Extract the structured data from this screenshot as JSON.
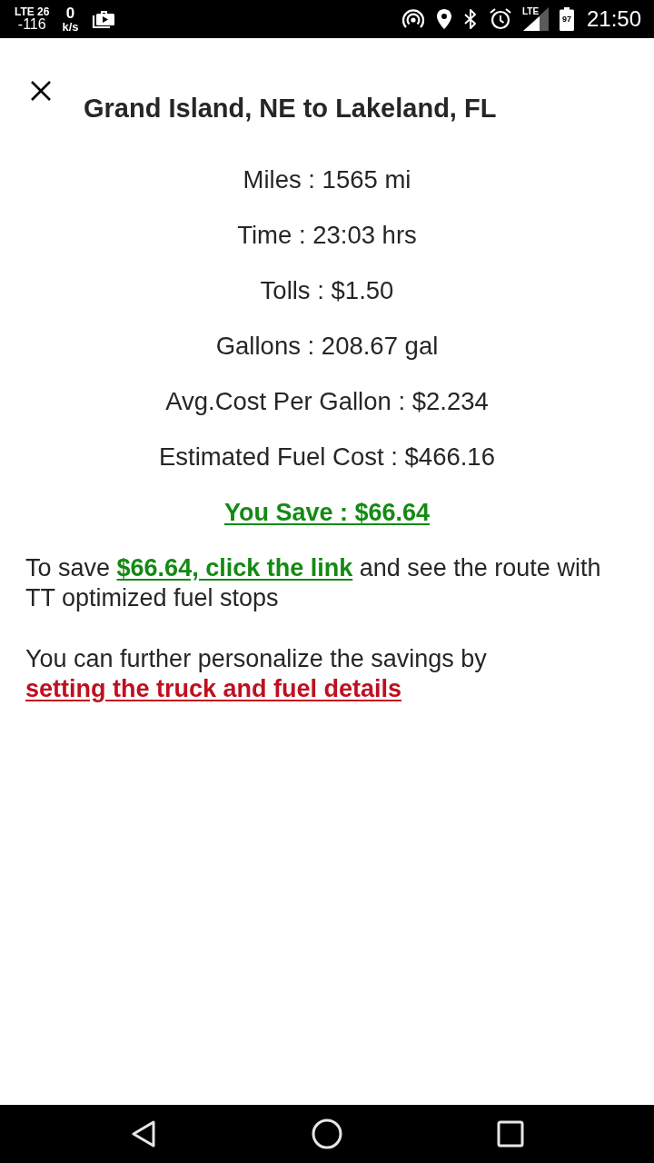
{
  "status_bar": {
    "network": "LTE 26",
    "signal_dbm": "-116",
    "speed_value": "0",
    "speed_unit": "k/s",
    "lte_label": "LTE",
    "battery": "97",
    "time": "21:50"
  },
  "header": {
    "title": "Grand Island, NE to Lakeland, FL"
  },
  "stats": [
    {
      "text": "Miles : 1565 mi"
    },
    {
      "text": "Time : 23:03 hrs"
    },
    {
      "text": "Tolls : $1.50"
    },
    {
      "text": "Gallons : 208.67 gal"
    },
    {
      "text": "Avg.Cost Per Gallon : $2.234"
    },
    {
      "text": "Estimated Fuel Cost : $466.16"
    }
  ],
  "savings": {
    "text": "You Save : $66.64",
    "color": "#138a13"
  },
  "paragraphs": [
    {
      "parts": [
        {
          "kind": "text",
          "text": "To save "
        },
        {
          "kind": "link",
          "text": "$66.64, click the link",
          "color": "#138a13"
        },
        {
          "kind": "text",
          "text": " and see the route with TT optimized fuel stops"
        }
      ]
    },
    {
      "parts": [
        {
          "kind": "text",
          "text": "You can further personalize the savings by "
        },
        {
          "kind": "link",
          "text": "setting the truck and fuel details",
          "color": "#bf1020"
        }
      ]
    }
  ]
}
